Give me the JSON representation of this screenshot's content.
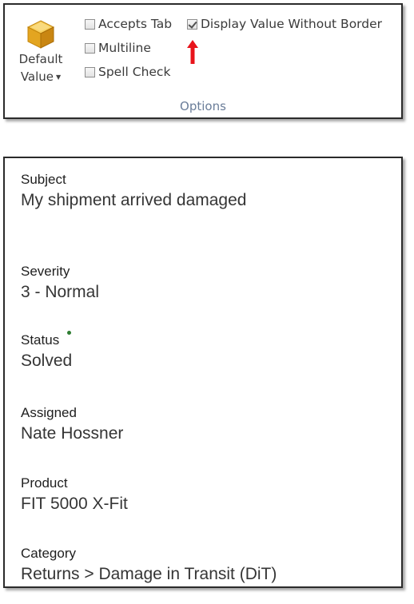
{
  "ribbon": {
    "default_value": {
      "label_line1": "Default",
      "label_line2": "Value",
      "icon": "cube-icon"
    },
    "options": {
      "accepts_tab": {
        "label": "Accepts Tab",
        "checked": false
      },
      "display_value_without_border": {
        "label": "Display Value Without Border",
        "checked": true
      },
      "multiline": {
        "label": "Multiline",
        "checked": false
      },
      "spell_check": {
        "label": "Spell Check",
        "checked": false
      }
    },
    "group_label": "Options",
    "annotation": {
      "icon": "red-up-arrow-icon",
      "color": "#e8141b"
    }
  },
  "form": {
    "fields": [
      {
        "label": "Subject",
        "value": "My shipment arrived damaged"
      },
      {
        "label": "Severity",
        "value": "3 - Normal"
      },
      {
        "label": "Status",
        "value": "Solved",
        "required_indicator": true
      },
      {
        "label": "Assigned",
        "value": "Nate Hossner"
      },
      {
        "label": "Product",
        "value": "FIT 5000 X-Fit"
      },
      {
        "label": "Category",
        "value": "Returns > Damage in Transit (DiT)"
      }
    ]
  },
  "colors": {
    "group_label": "#6a7d99",
    "required_dot": "#2e7d32",
    "cube_top": "#f5c24c",
    "cube_left": "#e2a21c",
    "cube_right": "#c98410"
  }
}
